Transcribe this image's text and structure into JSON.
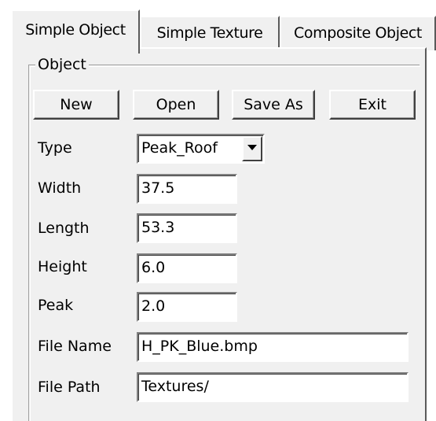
{
  "tabs": [
    {
      "label": "Simple Object",
      "active": true
    },
    {
      "label": "Simple Texture",
      "active": false
    },
    {
      "label": "Composite Object",
      "active": false
    }
  ],
  "group": {
    "label": "Object"
  },
  "buttons": {
    "new_label": "New",
    "open_label": "Open",
    "save_as_label": "Save As",
    "exit_label": "Exit"
  },
  "fields": {
    "type": {
      "label": "Type",
      "value": "Peak_Roof"
    },
    "width": {
      "label": "Width",
      "value": "37.5"
    },
    "length": {
      "label": "Length",
      "value": "53.3"
    },
    "height": {
      "label": "Height",
      "value": "6.0"
    },
    "peak": {
      "label": "Peak",
      "value": "2.0"
    },
    "file_name": {
      "label": "File Name",
      "value": "H_PK_Blue.bmp"
    },
    "file_path": {
      "label": "File Path",
      "value": "Textures/"
    }
  },
  "icons": {
    "dropdown": "chevron-down-icon"
  },
  "colors": {
    "face": "#f0f0f0",
    "field_bg": "#ffffff",
    "shadow": "#808080",
    "dark_shadow": "#404040"
  }
}
